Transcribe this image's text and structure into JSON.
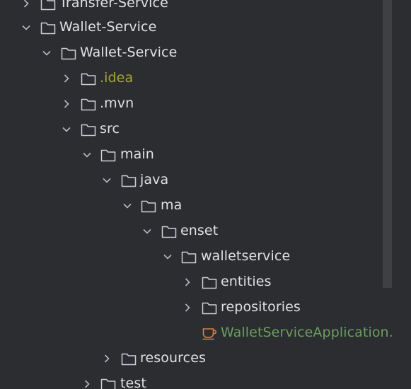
{
  "tree": {
    "items": [
      {
        "label": "Transfer-Service",
        "expanded": false,
        "type": "folder"
      },
      {
        "label": "Wallet-Service",
        "expanded": true,
        "type": "folder"
      },
      {
        "label": "Wallet-Service",
        "expanded": true,
        "type": "folder"
      },
      {
        "label": ".idea",
        "expanded": false,
        "type": "folder"
      },
      {
        "label": ".mvn",
        "expanded": false,
        "type": "folder"
      },
      {
        "label": "src",
        "expanded": true,
        "type": "folder"
      },
      {
        "label": "main",
        "expanded": true,
        "type": "folder"
      },
      {
        "label": "java",
        "expanded": true,
        "type": "folder"
      },
      {
        "label": "ma",
        "expanded": true,
        "type": "folder"
      },
      {
        "label": "enset",
        "expanded": true,
        "type": "folder"
      },
      {
        "label": "walletservice",
        "expanded": true,
        "type": "folder"
      },
      {
        "label": "entities",
        "expanded": false,
        "type": "folder"
      },
      {
        "label": "repositories",
        "expanded": false,
        "type": "folder"
      },
      {
        "label": "WalletServiceApplication.ja",
        "type": "java-class"
      },
      {
        "label": "resources",
        "expanded": false,
        "type": "folder"
      },
      {
        "label": "test",
        "expanded": false,
        "type": "folder"
      }
    ]
  },
  "colors": {
    "background": "#2b2d30",
    "text": "#dfe1e5",
    "ignored_text": "#a6a436",
    "java_class_text": "#6b9e5e",
    "java_icon": "#e07d46",
    "scrollbar": "#3e4044"
  }
}
